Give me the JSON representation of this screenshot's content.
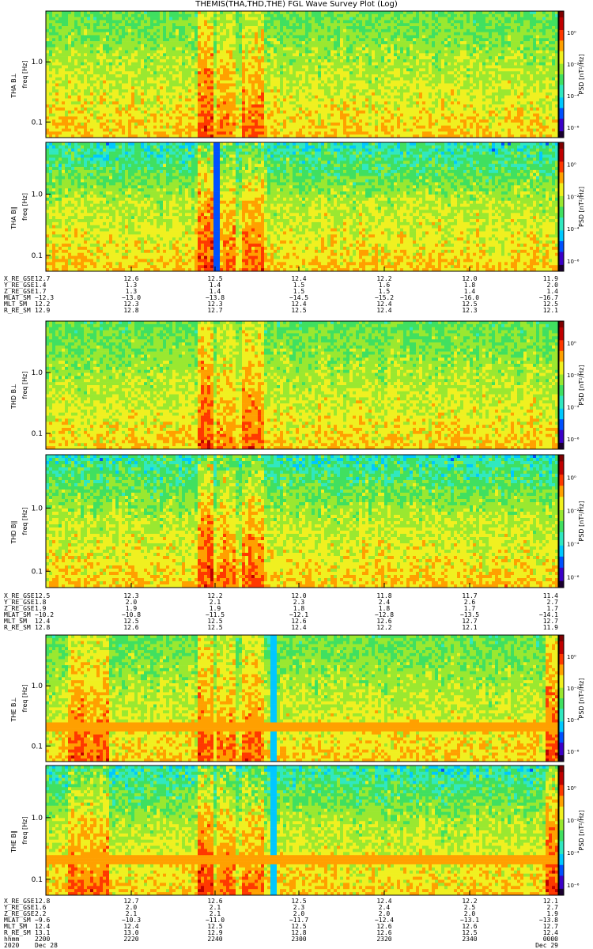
{
  "title": "THEMIS(THA,THD,THE) FGL Wave Survey Plot (Log)",
  "colors": {
    "scale": [
      "#1a0030",
      "#3a00c8",
      "#0050ff",
      "#00c8ff",
      "#30e8c0",
      "#40e060",
      "#9ae830",
      "#f0f020",
      "#ffa000",
      "#ff3800",
      "#c00000",
      "#800000"
    ],
    "background": "#ffffff"
  },
  "chart_data": [
    {
      "type": "heatmap",
      "panels": [
        {
          "ylabel_probe": "THA B⊥",
          "ylabel_freq": "freq [Hz]",
          "cbar_label": "PSD [nT²/Hz]",
          "cbar_ticks": [
            "10⁰",
            "10⁻²",
            "10⁻⁴",
            "10⁻⁶"
          ],
          "y_ticks": [
            "1.0",
            "0.1"
          ],
          "yscale": "log",
          "features": [
            "hot band near 12.6 R",
            "quiet background",
            "high-freq green/yellow"
          ]
        },
        {
          "ylabel_probe": "THA B∥",
          "ylabel_freq": "freq [Hz]",
          "cbar_label": "PSD [nT²/Hz]",
          "cbar_ticks": [
            "10⁰",
            "10⁻²",
            "10⁻⁴",
            "10⁻⁶"
          ],
          "y_ticks": [
            "1.0",
            "0.1"
          ],
          "yscale": "log"
        }
      ],
      "ephemeris": {
        "labels": [
          "X_RE_GSE",
          "Y_RE_GSE",
          "Z_RE_GSE",
          "MLAT_SM",
          "MLT_SM",
          "R_RE_SM"
        ],
        "columns": [
          [
            "12.7",
            "1.4",
            "1.7",
            "−12.3",
            "12.2",
            "12.9"
          ],
          [
            "12.6",
            "1.3",
            "1.3",
            "−13.0",
            "12.3",
            "12.8"
          ],
          [
            "12.5",
            "1.4",
            "1.4",
            "−13.8",
            "12.3",
            "12.7"
          ],
          [
            "12.4",
            "1.5",
            "1.5",
            "−14.5",
            "12.4",
            "12.5"
          ],
          [
            "12.2",
            "1.6",
            "1.5",
            "−15.2",
            "12.4",
            "12.4"
          ],
          [
            "12.0",
            "1.8",
            "1.4",
            "−16.0",
            "12.5",
            "12.3"
          ],
          [
            "11.9",
            "2.0",
            "1.4",
            "−16.7",
            "12.5",
            "12.1"
          ]
        ]
      }
    },
    {
      "type": "heatmap",
      "panels": [
        {
          "ylabel_probe": "THD B⊥",
          "ylabel_freq": "freq [Hz]",
          "cbar_label": "PSD [nT²/Hz]",
          "cbar_ticks": [
            "10⁰",
            "10⁻²",
            "10⁻⁴",
            "10⁻⁶"
          ],
          "y_ticks": [
            "1.0",
            "0.1"
          ],
          "yscale": "log"
        },
        {
          "ylabel_probe": "THD B∥",
          "ylabel_freq": "freq [Hz]",
          "cbar_label": "PSD [nT²/Hz]",
          "cbar_ticks": [
            "10⁰",
            "10⁻²",
            "10⁻⁴",
            "10⁻⁶"
          ],
          "y_ticks": [
            "1.0",
            "0.1"
          ],
          "yscale": "log"
        }
      ],
      "ephemeris": {
        "labels": [
          "X_RE_GSE",
          "Y_RE_GSE",
          "Z_RE_GSE",
          "MLAT_SM",
          "MLT_SM",
          "R_RE_SM"
        ],
        "columns": [
          [
            "12.5",
            "1.8",
            "1.9",
            "−10.2",
            "12.4",
            "12.8"
          ],
          [
            "12.3",
            "2.0",
            "1.9",
            "−10.8",
            "12.5",
            "12.6"
          ],
          [
            "12.2",
            "2.1",
            "1.9",
            "−11.5",
            "12.5",
            "12.5"
          ],
          [
            "12.0",
            "2.3",
            "1.8",
            "−12.1",
            "12.6",
            "12.4"
          ],
          [
            "11.8",
            "2.4",
            "1.8",
            "−12.8",
            "12.6",
            "12.2"
          ],
          [
            "11.7",
            "2.6",
            "1.7",
            "−13.5",
            "12.7",
            "12.1"
          ],
          [
            "11.4",
            "2.7",
            "1.7",
            "−14.1",
            "12.7",
            "11.9"
          ]
        ]
      }
    },
    {
      "type": "heatmap",
      "panels": [
        {
          "ylabel_probe": "THE B⊥",
          "ylabel_freq": "freq [Hz]",
          "cbar_label": "PSD [nT²/Hz]",
          "cbar_ticks": [
            "10⁰",
            "10⁻²",
            "10⁻⁴",
            "10⁻⁶"
          ],
          "y_ticks": [
            "1.0",
            "0.1"
          ],
          "yscale": "log"
        },
        {
          "ylabel_probe": "THE B∥",
          "ylabel_freq": "freq [Hz]",
          "cbar_label": "PSD [nT²/Hz]",
          "cbar_ticks": [
            "10⁰",
            "10⁻²",
            "10⁻⁴",
            "10⁻⁶"
          ],
          "y_ticks": [
            "1.0",
            "0.1"
          ],
          "yscale": "log"
        }
      ],
      "ephemeris": {
        "labels": [
          "X_RE_GSE",
          "Y_RE_GSE",
          "Z_RE_GSE",
          "MLAT_SM",
          "MLT_SM",
          "R_RE_SM",
          "hhmm",
          "2020"
        ],
        "columns": [
          [
            "12.8",
            "1.6",
            "2.2",
            "−9.6",
            "12.4",
            "13.1",
            "2200",
            "Dec 28"
          ],
          [
            "12.7",
            "2.0",
            "2.1",
            "−10.3",
            "12.4",
            "13.0",
            "2220",
            ""
          ],
          [
            "12.6",
            "2.1",
            "2.1",
            "−11.0",
            "12.5",
            "12.9",
            "2240",
            ""
          ],
          [
            "12.5",
            "2.3",
            "2.0",
            "−11.7",
            "12.5",
            "12.8",
            "2300",
            ""
          ],
          [
            "12.4",
            "2.4",
            "2.0",
            "−12.4",
            "12.6",
            "12.6",
            "2320",
            ""
          ],
          [
            "12.2",
            "2.5",
            "2.0",
            "−13.1",
            "12.6",
            "12.5",
            "2340",
            ""
          ],
          [
            "12.1",
            "2.7",
            "1.9",
            "−13.8",
            "12.7",
            "12.4",
            "0000",
            "Dec 29"
          ]
        ]
      }
    }
  ]
}
